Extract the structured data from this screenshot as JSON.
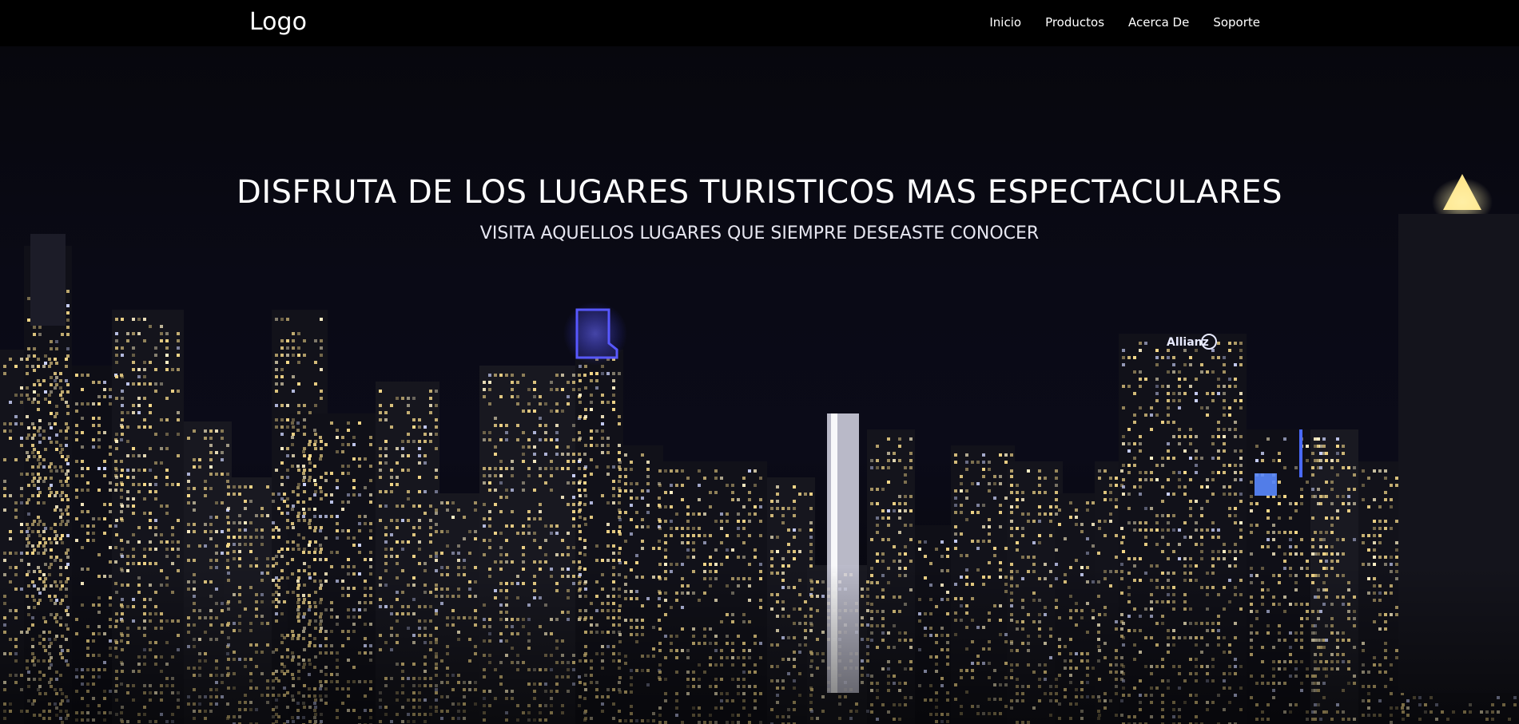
{
  "header": {
    "logo": "Logo",
    "nav": [
      {
        "label": "Inicio"
      },
      {
        "label": "Productos"
      },
      {
        "label": "Acerca De"
      },
      {
        "label": "Soporte"
      }
    ]
  },
  "hero": {
    "title": "DISFRUTA DE LOS LUGARES TURISTICOS MAS ESPECTACULARES",
    "subtitle": "VISITA AQUELLOS LUGARES QUE SIEMPRE DESEASTE CONOCER",
    "background_image": "night-city-skyline",
    "sign_text": "Allianz"
  },
  "colors": {
    "navbar": "#000000",
    "sky": "#0a0a16",
    "window_light": "#f5d98a",
    "accent_blue": "#3a4dff"
  }
}
